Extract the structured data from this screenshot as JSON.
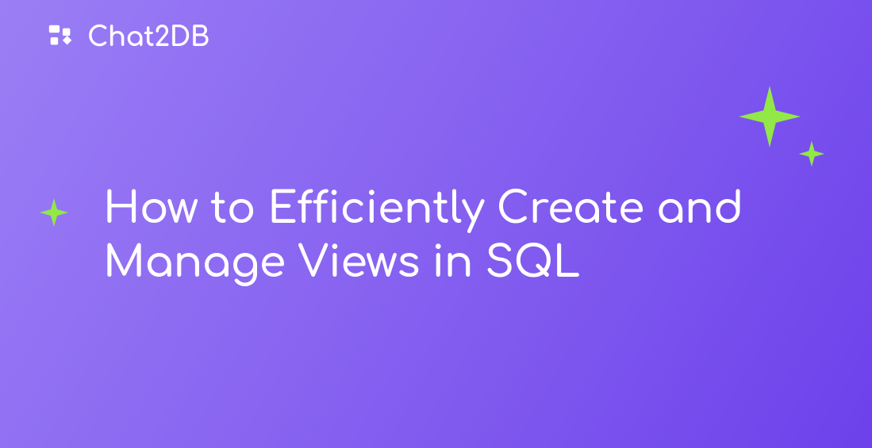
{
  "brand": {
    "name": "Chat2DB"
  },
  "heading": {
    "text": "How to Efficiently Create and Manage Views in SQL"
  },
  "colors": {
    "sparkle": "#92E847",
    "text": "#FFFFFF"
  }
}
